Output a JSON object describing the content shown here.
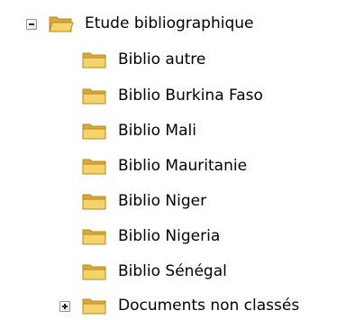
{
  "tree": {
    "root": {
      "label": "Etude bibliographique",
      "icon": "folder-open-icon",
      "state": "expanded",
      "children": [
        {
          "label": "Biblio autre",
          "icon": "folder-icon"
        },
        {
          "label": "Biblio Burkina Faso",
          "icon": "folder-icon"
        },
        {
          "label": "Biblio Mali",
          "icon": "folder-icon"
        },
        {
          "label": "Biblio Mauritanie",
          "icon": "folder-icon"
        },
        {
          "label": "Biblio Niger",
          "icon": "folder-icon"
        },
        {
          "label": "Biblio Nigeria",
          "icon": "folder-icon"
        },
        {
          "label": "Biblio Sénégal",
          "icon": "folder-icon"
        }
      ]
    },
    "sibling": {
      "label": "Documents non classés",
      "icon": "folder-icon",
      "state": "collapsed"
    },
    "colors": {
      "folder_fill": "#f4d36a",
      "folder_shade": "#dca83c",
      "folder_stroke": "#b88a20",
      "toggle_border": "#8c97a5"
    }
  }
}
